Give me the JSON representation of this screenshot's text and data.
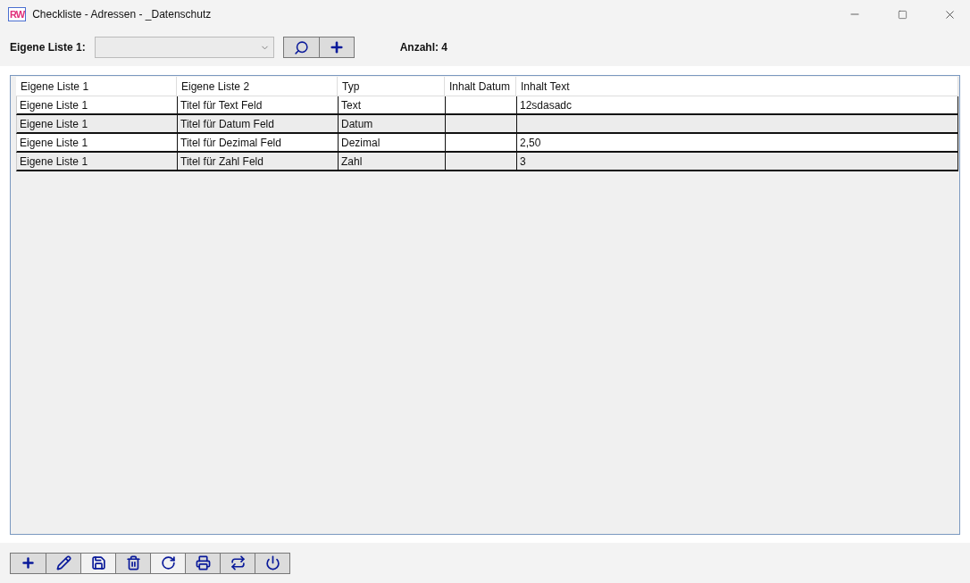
{
  "window": {
    "logo": "RW",
    "title": "Checkliste - Adressen - _Datenschutz"
  },
  "filter": {
    "label": "Eigene Liste 1:",
    "count": "Anzahl: 4"
  },
  "table": {
    "columns": [
      "Eigene Liste 1",
      "Eigene Liste 2",
      "Typ",
      "Inhalt Datum",
      "Inhalt Text"
    ],
    "rows": [
      {
        "cells": [
          "Eigene Liste 1",
          "Titel für Text Feld",
          "Text",
          "",
          "12sdasadc"
        ]
      },
      {
        "cells": [
          "Eigene Liste 1",
          "Titel für Datum Feld",
          "Datum",
          "",
          ""
        ]
      },
      {
        "cells": [
          "Eigene Liste 1",
          "Titel für Dezimal Feld",
          "Dezimal",
          "",
          "2,50"
        ]
      },
      {
        "cells": [
          "Eigene Liste 1",
          "Titel für Zahl Feld",
          "Zahl",
          "",
          "3"
        ]
      }
    ]
  },
  "toolbar": [
    {
      "kind": "add",
      "light": false
    },
    {
      "kind": "edit",
      "light": false
    },
    {
      "kind": "save",
      "light": true
    },
    {
      "kind": "delete",
      "light": false
    },
    {
      "kind": "refresh",
      "light": true
    },
    {
      "kind": "print",
      "light": false
    },
    {
      "kind": "swap",
      "light": false
    },
    {
      "kind": "power",
      "light": false
    }
  ]
}
